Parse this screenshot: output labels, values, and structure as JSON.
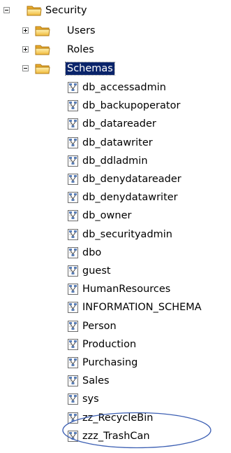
{
  "tree": {
    "root": {
      "label": "Security",
      "expander": "minus",
      "icon": "folder-icon"
    },
    "children": [
      {
        "label": "Users",
        "expander": "plus",
        "icon": "folder-icon"
      },
      {
        "label": "Roles",
        "expander": "plus",
        "icon": "folder-icon"
      },
      {
        "label": "Schemas",
        "expander": "minus",
        "icon": "folder-icon",
        "selected": true
      }
    ],
    "schemas": [
      "db_accessadmin",
      "db_backupoperator",
      "db_datareader",
      "db_datawriter",
      "db_ddladmin",
      "db_denydatareader",
      "db_denydatawriter",
      "db_owner",
      "db_securityadmin",
      "dbo",
      "guest",
      "HumanResources",
      "INFORMATION_SCHEMA",
      "Person",
      "Production",
      "Purchasing",
      "Sales",
      "sys",
      "zz_RecycleBin",
      "zzz_TrashCan"
    ],
    "schema_icon": "schema-icon",
    "highlighted_items": [
      "zz_RecycleBin",
      "zzz_TrashCan"
    ],
    "highlight_color": "#3c5fb3",
    "selection_color": "#0a246a",
    "folder_color": "#f5c84c"
  }
}
